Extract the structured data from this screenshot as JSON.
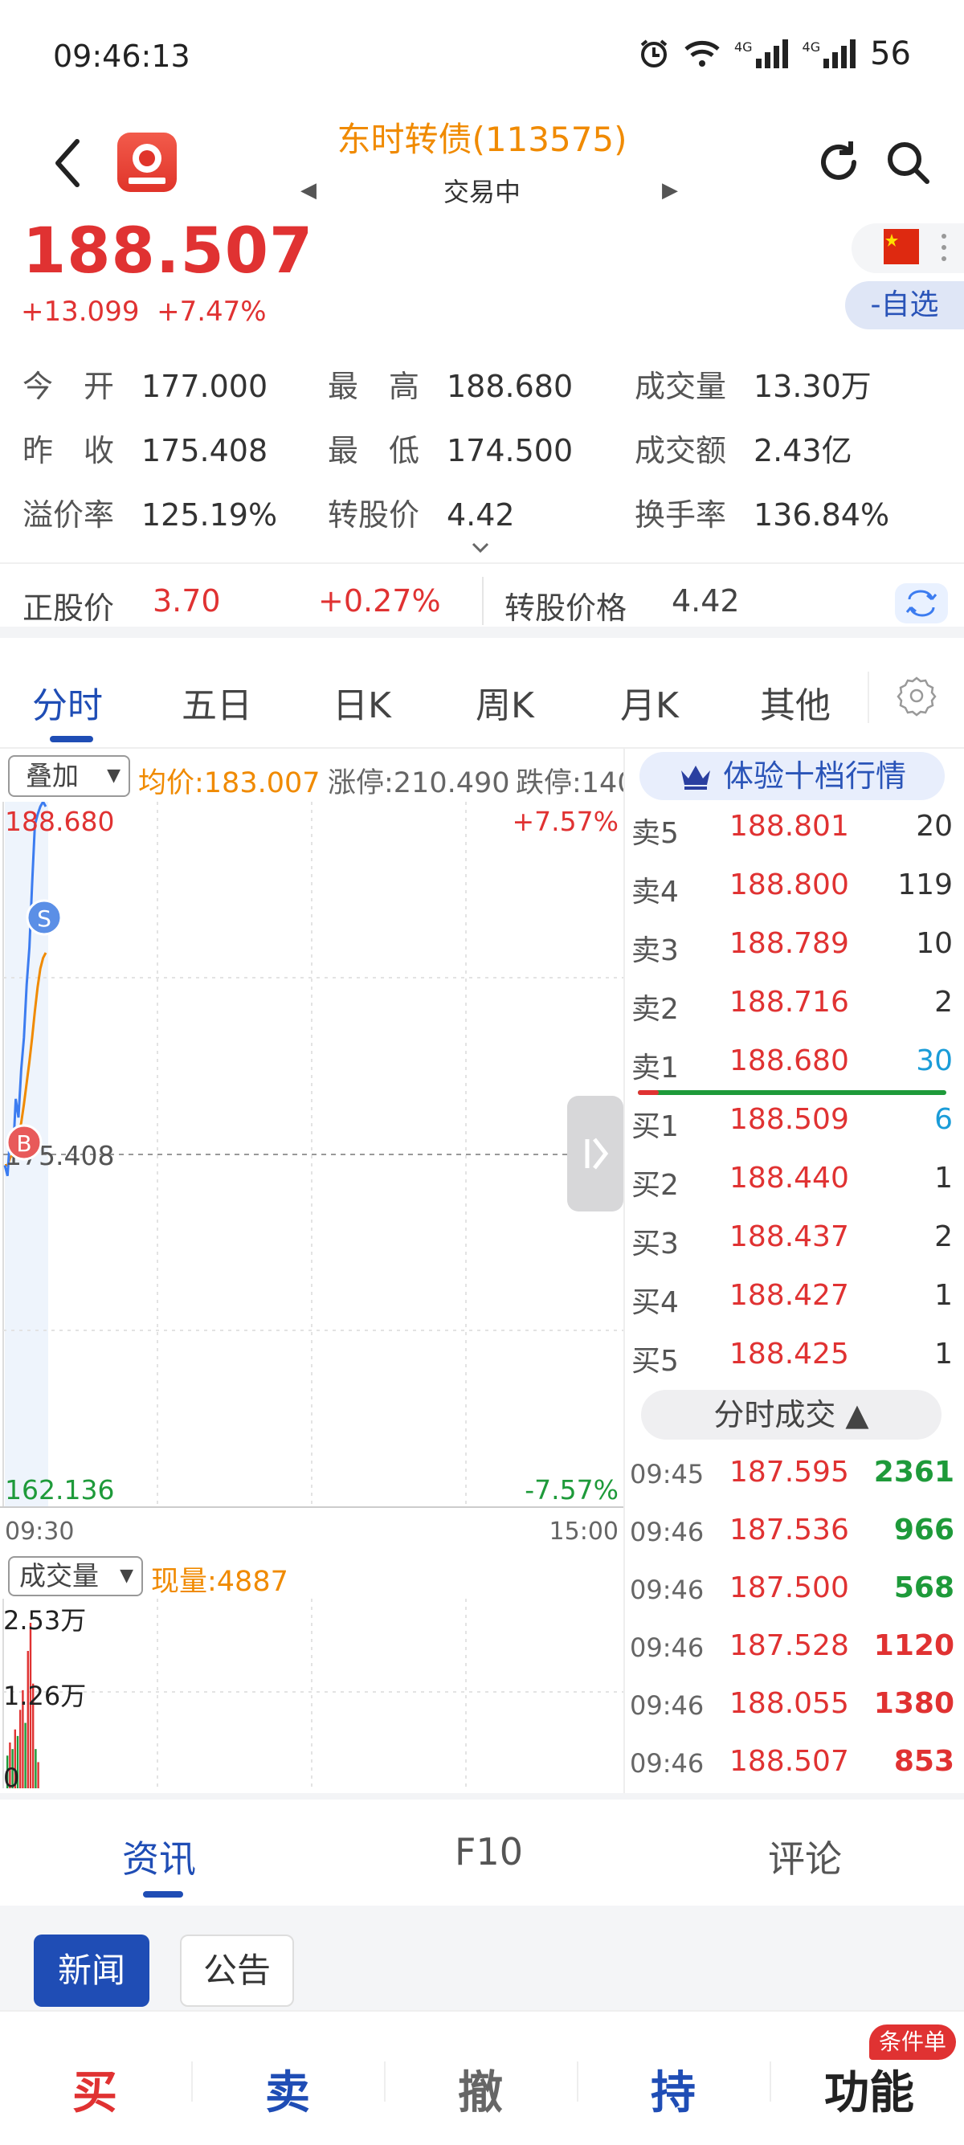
{
  "status_bar": {
    "time": "09:46:13",
    "network_1": "4G",
    "network_2": "4G",
    "battery": "56"
  },
  "header": {
    "title": "东时转债(113575)",
    "subtitle": "交易中",
    "prev_arrow": "◀",
    "next_arrow": "▶"
  },
  "quote": {
    "price": "188.507",
    "change": "+13.099",
    "change_pct": "+7.47%",
    "watch_label": "-自选"
  },
  "stats": [
    {
      "label": "今　开",
      "value": "177.000"
    },
    {
      "label": "最　高",
      "value": "188.680"
    },
    {
      "label": "成交量",
      "value": "13.30万"
    },
    {
      "label": "昨　收",
      "value": "175.408"
    },
    {
      "label": "最　低",
      "value": "174.500"
    },
    {
      "label": "成交额",
      "value": "2.43亿"
    },
    {
      "label": "溢价率",
      "value": "125.19%"
    },
    {
      "label": "转股价",
      "value": "4.42"
    },
    {
      "label": "换手率",
      "value": "136.84%"
    }
  ],
  "underlying": {
    "stock_label": "正股价",
    "stock_price": "3.70",
    "stock_change": "+0.27%",
    "conv_label": "转股价格",
    "conv_price": "4.42"
  },
  "chart_tabs": [
    "分时",
    "五日",
    "日K",
    "周K",
    "月K",
    "其他"
  ],
  "chart_header": {
    "overlay_label": "叠加",
    "avg_price": "均价:183.007",
    "limit_up": "涨停:210.490",
    "limit_down": "跌停:140"
  },
  "chart_data": {
    "type": "line",
    "y_high_label": "188.680",
    "y_mid_label": "175.408",
    "y_low_label": "162.136",
    "pct_high_label": "+7.57%",
    "pct_low_label": "-7.57%",
    "x_start_label": "09:30",
    "x_end_label": "15:00",
    "ylim": [
      162.136,
      188.68
    ],
    "series": [
      {
        "name": "price",
        "values": [
          175.0,
          174.6,
          176.2,
          175.4,
          177.5,
          176.8,
          178.6,
          179.8,
          181.8,
          183.2,
          185.6,
          187.8,
          188.2,
          188.5,
          188.68,
          188.5
        ]
      },
      {
        "name": "avg",
        "values": [
          175.0,
          175.0,
          175.3,
          175.4,
          175.8,
          176.1,
          176.6,
          177.3,
          178.1,
          178.9,
          179.8,
          180.8,
          181.7,
          182.4,
          182.8,
          183.0
        ]
      }
    ],
    "markers": [
      {
        "label": "S"
      },
      {
        "label": "B"
      }
    ],
    "volume": {
      "series_label": "成交量",
      "current": "现量:4887",
      "y_top_label": "2.53万",
      "y_mid_label": "1.26万",
      "y_zero_label": "0",
      "bars": [
        {
          "value": 0.5,
          "color": "#1e9a3a"
        },
        {
          "value": 0.7,
          "color": "#e03232"
        },
        {
          "value": 0.6,
          "color": "#1e9a3a"
        },
        {
          "value": 0.9,
          "color": "#e03232"
        },
        {
          "value": 0.8,
          "color": "#1e9a3a"
        },
        {
          "value": 1.2,
          "color": "#e03232"
        },
        {
          "value": 1.5,
          "color": "#e03232"
        },
        {
          "value": 1.0,
          "color": "#1e9a3a"
        },
        {
          "value": 2.1,
          "color": "#e03232"
        },
        {
          "value": 2.53,
          "color": "#e03232"
        },
        {
          "value": 1.6,
          "color": "#e03232"
        },
        {
          "value": 0.6,
          "color": "#1e9a3a"
        },
        {
          "value": 0.4,
          "color": "#e03232"
        }
      ]
    }
  },
  "order_book": {
    "title": "体验十档行情",
    "asks": [
      {
        "label": "卖5",
        "price": "188.801",
        "volume": "20"
      },
      {
        "label": "卖4",
        "price": "188.800",
        "volume": "119"
      },
      {
        "label": "卖3",
        "price": "188.789",
        "volume": "10"
      },
      {
        "label": "卖2",
        "price": "188.716",
        "volume": "2"
      },
      {
        "label": "卖1",
        "price": "188.680",
        "volume": "30"
      }
    ],
    "bids": [
      {
        "label": "买1",
        "price": "188.509",
        "volume": "6"
      },
      {
        "label": "买2",
        "price": "188.440",
        "volume": "1"
      },
      {
        "label": "买3",
        "price": "188.437",
        "volume": "2"
      },
      {
        "label": "买4",
        "price": "188.427",
        "volume": "1"
      },
      {
        "label": "买5",
        "price": "188.425",
        "volume": "1"
      }
    ],
    "ticks_label": "分时成交 ▲",
    "ticks": [
      {
        "time": "09:45",
        "price": "187.595",
        "volume": "2361",
        "color": "#1e9a3a"
      },
      {
        "time": "09:46",
        "price": "187.536",
        "volume": "966",
        "color": "#1e9a3a"
      },
      {
        "time": "09:46",
        "price": "187.500",
        "volume": "568",
        "color": "#1e9a3a"
      },
      {
        "time": "09:46",
        "price": "187.528",
        "volume": "1120",
        "color": "#e03232"
      },
      {
        "time": "09:46",
        "price": "188.055",
        "volume": "1380",
        "color": "#e03232"
      },
      {
        "time": "09:46",
        "price": "188.507",
        "volume": "853",
        "color": "#e03232"
      }
    ]
  },
  "info_tabs": [
    "资讯",
    "F10",
    "评论"
  ],
  "news_buttons": {
    "news": "新闻",
    "notice": "公告"
  },
  "trade_bar": {
    "buy": "买",
    "sell": "卖",
    "cancel": "撤",
    "hold": "持",
    "func": "功能",
    "badge": "条件单",
    "buy_color": "#e03232",
    "sell_color": "#1f4db5",
    "cancel_color": "#666666",
    "hold_color": "#1f4db5",
    "func_color": "#222222"
  }
}
